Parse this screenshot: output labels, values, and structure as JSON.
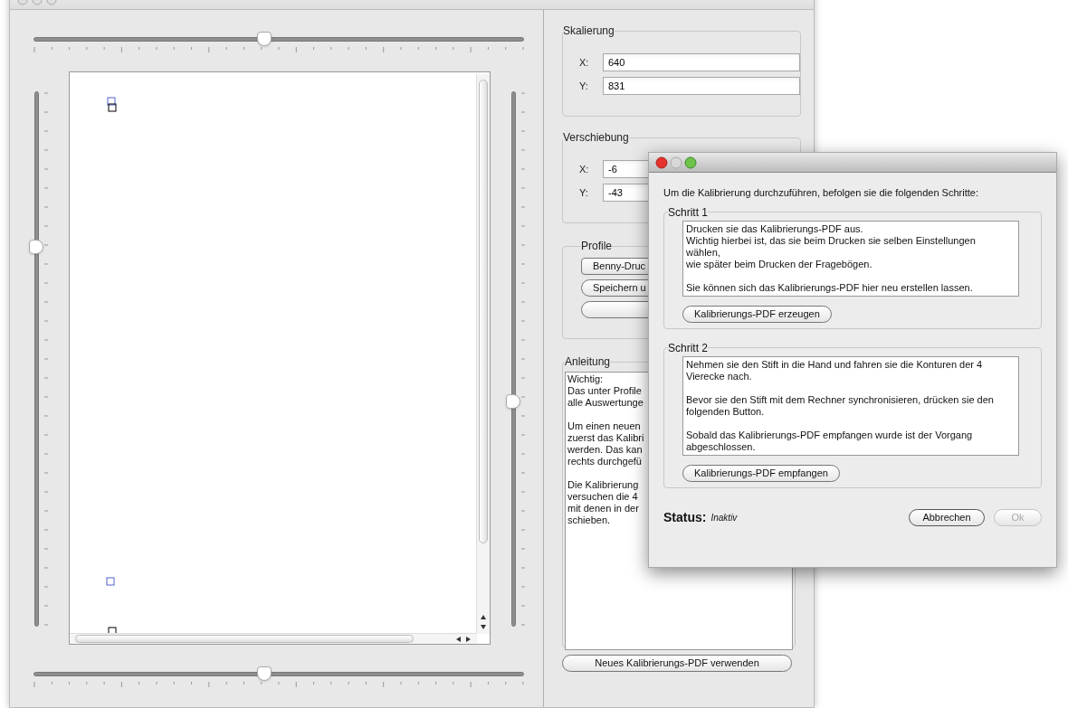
{
  "main_window": {
    "sliders": {
      "top": {
        "level": 0.47
      },
      "left": {
        "level": 0.71
      },
      "right": {
        "level": 0.42
      },
      "bottom": {
        "level": 0.47
      }
    },
    "skalierung": {
      "title": "Skalierung",
      "fields": [
        {
          "label": "X:",
          "value": "640"
        },
        {
          "label": "Y:",
          "value": "831"
        }
      ]
    },
    "verschiebung": {
      "title": "Verschiebung",
      "fields": [
        {
          "label": "X:",
          "value": "-6"
        },
        {
          "label": "Y:",
          "value": "-43"
        }
      ]
    },
    "profile": {
      "title": "Profile",
      "buttons": [
        {
          "label": "Benny-Druc",
          "kind": "menu"
        },
        {
          "label": "Speichern u",
          "kind": "push"
        },
        {
          "kind": "push"
        }
      ]
    },
    "anleitung": {
      "title": "Anleitung",
      "paragraphs": [
        [
          "Wichtig:",
          "Das unter Profile",
          "alle Auswertunge"
        ],
        [
          "Um einen neuen",
          "zuerst das Kalibri",
          "werden. Das kan",
          "rechts durchgefü"
        ],
        [
          "Die Kalibrierung",
          "versuchen die 4",
          "mit denen in der",
          "schieben."
        ]
      ]
    },
    "bottom_button": "Neues Kalibrierungs-PDF verwenden"
  },
  "dialog": {
    "intro": "Um die Kalibrierung durchzuführen, befolgen sie die folgenden Schritte:",
    "steps": [
      {
        "title": "Schritt 1",
        "paragraphs": [
          "Drucken sie das Kalibrierungs-PDF aus.\nWichtig hierbei ist, das sie beim Drucken sie selben Einstellungen\nwählen,\nwie später beim Drucken der Fragebögen.",
          "Sie können sich das Kalibrierungs-PDF hier neu erstellen lassen."
        ],
        "button": "Kalibrierungs-PDF erzeugen"
      },
      {
        "title": "Schritt 2",
        "paragraphs": [
          "Nehmen sie den Stift in die Hand und fahren sie die Konturen der 4\nVierecke nach.",
          "Bevor sie den Stift mit dem Rechner synchronisieren, drücken sie den\nfolgenden Button.",
          "Sobald das Kalibrierungs-PDF empfangen wurde ist der Vorgang\nabgeschlossen."
        ],
        "button": "Kalibrierungs-PDF empfangen"
      }
    ],
    "status_label": "Status:",
    "status_value": "Inaktiv",
    "buttons": [
      {
        "label": "Abbrechen",
        "disabled": false
      },
      {
        "label": "Ok",
        "disabled": true
      }
    ]
  }
}
